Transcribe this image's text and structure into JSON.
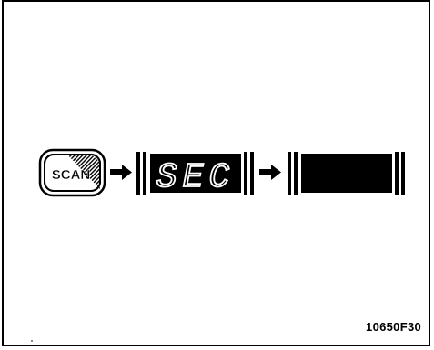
{
  "diagram": {
    "scan_button": {
      "label": "SCAN"
    },
    "display_1": {
      "readout": "SEC"
    },
    "display_2": {
      "readout": ""
    },
    "figure_id": "10650F30"
  },
  "colors": {
    "ink": "#000000",
    "paper": "#ffffff",
    "segment_lit": "#ffffff",
    "display_bg": "#000000"
  },
  "icons": [
    "scan-button-icon",
    "arrow-right-icon",
    "lcd-display-icon"
  ]
}
